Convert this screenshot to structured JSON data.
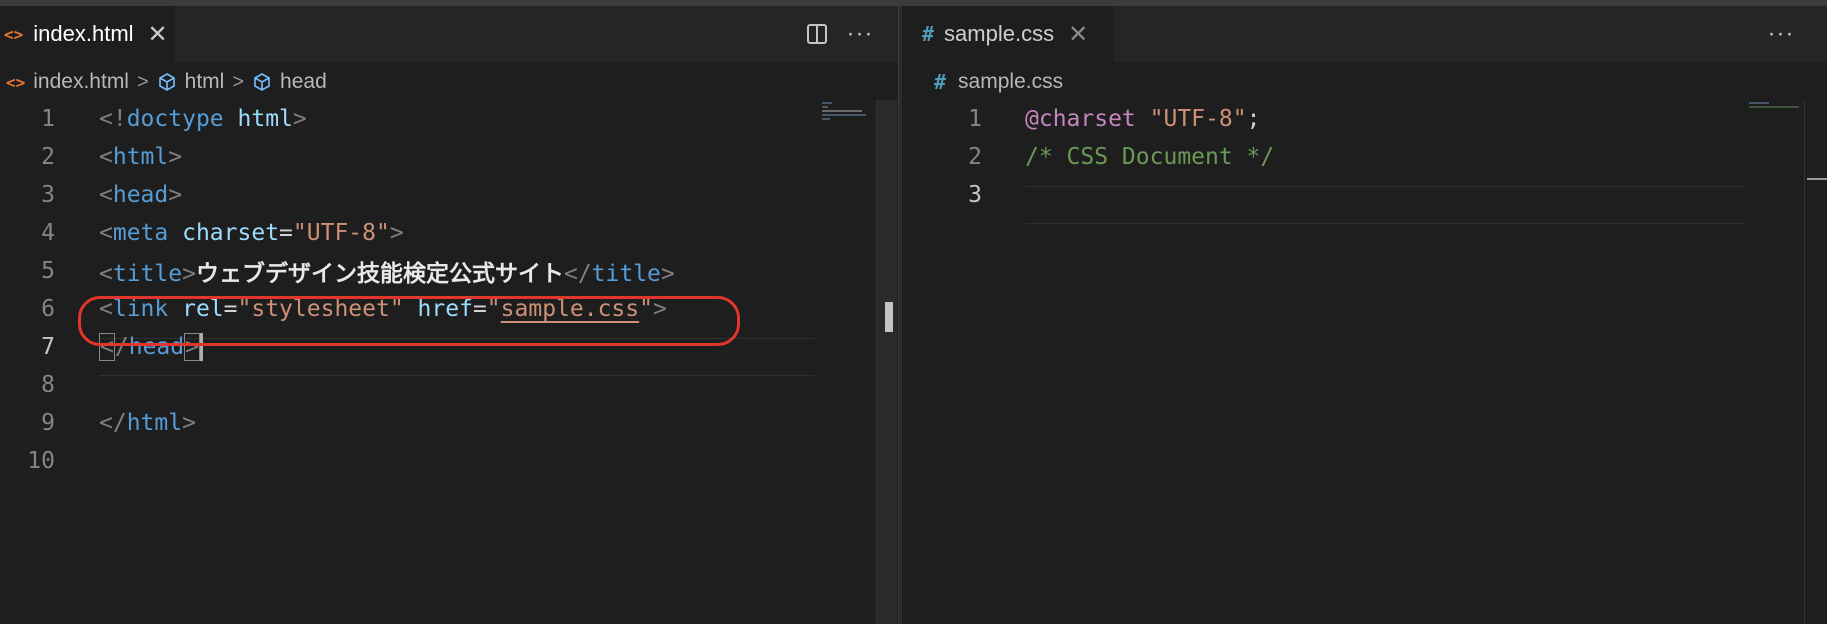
{
  "left_editor": {
    "tab": {
      "icon": "<>",
      "label": "index.html",
      "close": "✕"
    },
    "actions": {
      "split": "split-editor",
      "more": "···"
    },
    "breadcrumb": [
      {
        "icon": "<>",
        "label": "index.html"
      },
      {
        "icon": "cube",
        "label": "html"
      },
      {
        "icon": "cube",
        "label": "head"
      }
    ],
    "separator": ">",
    "lines": [
      {
        "n": "1",
        "parts": [
          "<!",
          "doctype",
          " ",
          "html",
          ">"
        ]
      },
      {
        "n": "2",
        "parts": [
          "<",
          "html",
          ">"
        ]
      },
      {
        "n": "3",
        "parts": [
          "<",
          "head",
          ">"
        ]
      },
      {
        "n": "4",
        "parts": [
          "<",
          "meta",
          " ",
          "charset",
          "=",
          "\"UTF-8\"",
          ">"
        ]
      },
      {
        "n": "5",
        "parts": [
          "<",
          "title",
          ">",
          "ウェブデザイン技能検定公式サイト",
          "</",
          "title",
          ">"
        ]
      },
      {
        "n": "6",
        "parts": [
          "<",
          "link",
          " ",
          "rel",
          "=",
          "\"stylesheet\"",
          " ",
          "href",
          "=",
          "\"",
          "sample.css",
          "\"",
          ">"
        ]
      },
      {
        "n": "7",
        "parts": [
          "<",
          "/",
          "head",
          ">"
        ]
      },
      {
        "n": "8",
        "parts": []
      },
      {
        "n": "9",
        "parts": [
          "</",
          "html",
          ">"
        ]
      },
      {
        "n": "10",
        "parts": []
      }
    ]
  },
  "right_editor": {
    "tab": {
      "icon": "#",
      "label": "sample.css",
      "close": "✕"
    },
    "actions": {
      "more": "···"
    },
    "breadcrumb": [
      {
        "icon": "#",
        "label": "sample.css"
      }
    ],
    "lines": [
      {
        "n": "1",
        "parts": [
          "@charset",
          " ",
          "\"UTF-8\"",
          ";"
        ]
      },
      {
        "n": "2",
        "parts": [
          "/* CSS Document */"
        ]
      },
      {
        "n": "3",
        "parts": []
      }
    ]
  },
  "colors": {
    "annotation_ring": "#e0362c",
    "tag": "#569cd6",
    "attribute": "#9cdcfe",
    "string": "#ce9178",
    "comment": "#6a9955",
    "at_rule": "#c586c0"
  }
}
